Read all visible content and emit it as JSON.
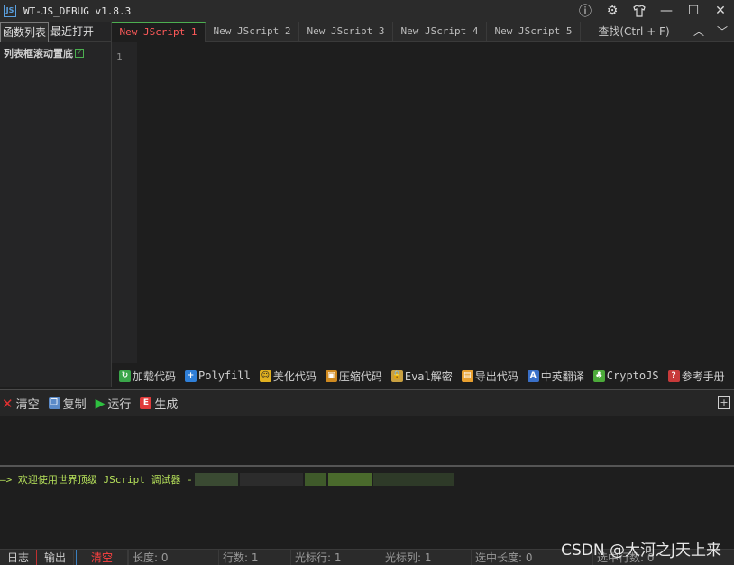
{
  "titlebar": {
    "app_icon_text": "JS",
    "title": "WT-JS_DEBUG v1.8.3"
  },
  "sidebar": {
    "tabs": [
      "函数列表",
      "最近打开"
    ],
    "scroll_bottom_label": "列表框滚动置底",
    "scroll_bottom_checked": true
  },
  "editor": {
    "tabs": [
      "New JScript 1",
      "New JScript 2",
      "New JScript 3",
      "New JScript 4",
      "New JScript 5"
    ],
    "find_label": "查找(Ctrl + F)",
    "line_numbers": [
      "1"
    ]
  },
  "editor_toolbar": {
    "load": "加载代码",
    "polyfill": "Polyfill",
    "beautify": "美化代码",
    "compress": "压缩代码",
    "eval": "Eval解密",
    "export": "导出代码",
    "translate": "中英翻译",
    "crypto": "CryptoJS",
    "manual": "参考手册"
  },
  "run_toolbar": {
    "clear": "清空",
    "copy": "复制",
    "run": "运行",
    "generate": "生成"
  },
  "output": {
    "line": "—> 欢迎使用世界顶级 JScript 调试器 -"
  },
  "statusbar": {
    "tab_log": "日志",
    "tab_output": "输出",
    "clear": "清空",
    "length": "长度: 0",
    "rows": "行数: 1",
    "cursor_row": "光标行: 1",
    "cursor_col": "光标列: 1",
    "sel_length": "选中长度: 0",
    "sel_rows": "选中行数: 0"
  },
  "watermark": "CSDN @大河之J天上来"
}
